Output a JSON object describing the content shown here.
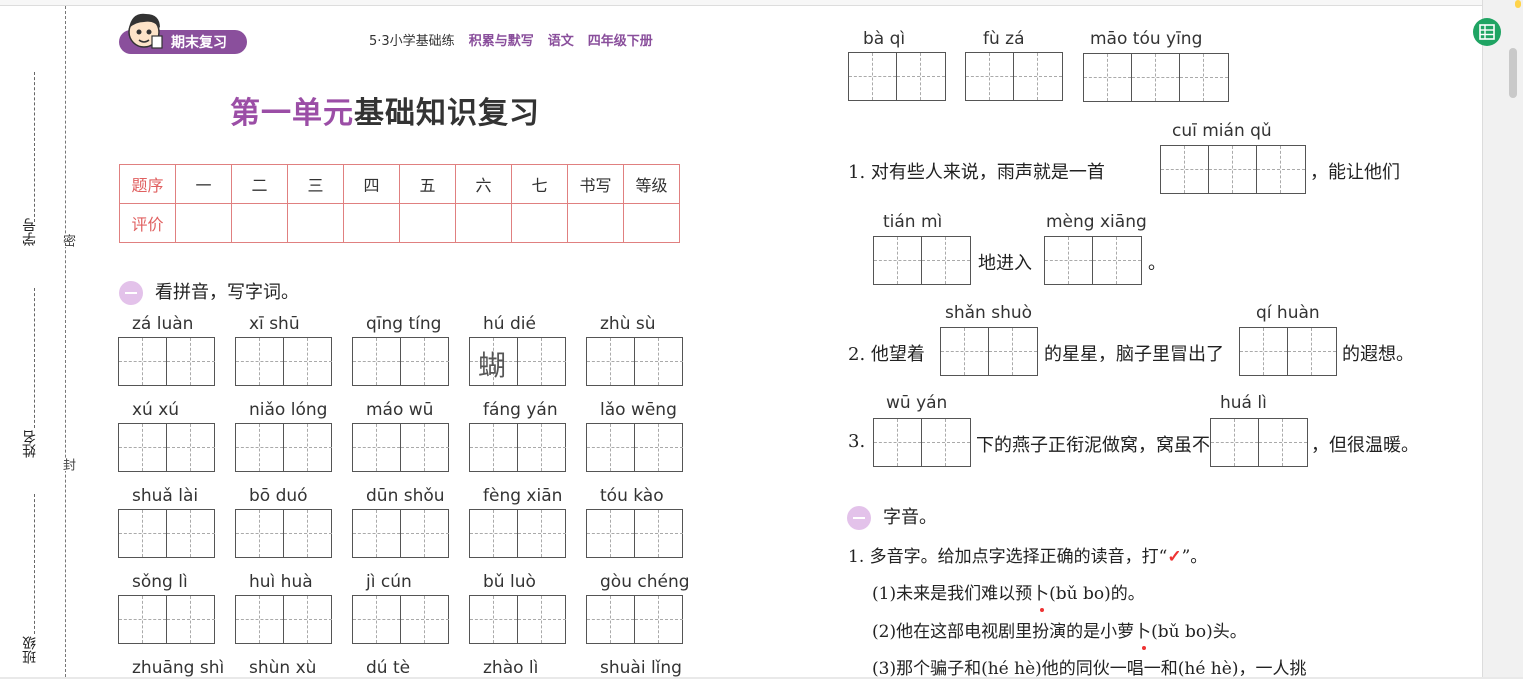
{
  "side_labels": {
    "student_no": "学号",
    "name": "姓名",
    "class": "班级",
    "seal_mi": "密",
    "seal_feng": "封"
  },
  "header": {
    "badge": "期末复习",
    "book": "5·3小学基础练",
    "series": "积累与默写",
    "subject": "语文",
    "grade": "四年级下册"
  },
  "title": {
    "prefix": "第一单元",
    "main": "基础知识复习"
  },
  "score_table": {
    "row1": [
      "题序",
      "一",
      "二",
      "三",
      "四",
      "五",
      "六",
      "七",
      "书写",
      "等级"
    ],
    "row2_head": "评价"
  },
  "section1": {
    "title": "看拼音，写字词。",
    "rows": [
      [
        {
          "py": "zá  luàn"
        },
        {
          "py": "xī   shū"
        },
        {
          "py": "qīng tíng"
        },
        {
          "py": "hú   dié",
          "filled": "蝴"
        },
        {
          "py": "zhù  sù"
        }
      ],
      [
        {
          "py": "xú   xú"
        },
        {
          "py": "niǎo lóng"
        },
        {
          "py": "máo  wū"
        },
        {
          "py": "fáng  yán"
        },
        {
          "py": "lǎo wēng"
        }
      ],
      [
        {
          "py": "shuǎ  lài"
        },
        {
          "py": "bō   duó"
        },
        {
          "py": "dūn shǒu"
        },
        {
          "py": "fèng xiān"
        },
        {
          "py": "tóu  kào"
        }
      ],
      [
        {
          "py": "sǒng   lì"
        },
        {
          "py": "huì  huà"
        },
        {
          "py": "jì   cún"
        },
        {
          "py": "bǔ   luò"
        },
        {
          "py": "gòu chéng"
        }
      ],
      [
        {
          "py": "zhuāng shì"
        },
        {
          "py": "shùn  xù"
        },
        {
          "py": "dú   tè"
        },
        {
          "py": "zhào   lì"
        },
        {
          "py": "shuài lǐng"
        }
      ]
    ]
  },
  "right_top": [
    {
      "py": "bà   qì"
    },
    {
      "py": "fù   zá"
    },
    {
      "py": "māo  tóu  yīng"
    }
  ],
  "fill_sentences": {
    "s1_py": "cuī  mián  qǔ",
    "s1_a": "1. 对有些人来说，雨声就是一首",
    "s1_b": "，能让他们",
    "s1_py2": "tián   mì",
    "s1_py3": "mèng xiāng",
    "s1_c": "地进入",
    "s1_d": "。",
    "s2_py1": "shǎn shuò",
    "s2_py2": "qí   huàn",
    "s2_a": "2. 他望着",
    "s2_b": "的星星，脑子里冒出了",
    "s2_c": "的遐想。",
    "s3_py1": "wū   yán",
    "s3_py2": "huá    lì",
    "s3_a": "3.",
    "s3_b": "下的燕子正衔泥做窝，窝虽不",
    "s3_c": "，但很温暖。"
  },
  "section2": {
    "title": "字音。",
    "q1": "1. 多音字。给加点字选择正确的读音，打“",
    "q1_end": "”。",
    "check": "✓",
    "items": [
      {
        "pre": "(1)未来是我们难以预",
        "dot": "卜",
        "post": "(bǔ   bo)的。"
      },
      {
        "pre": "(2)他在这部电视剧里扮演的是小萝",
        "dot": "卜",
        "post": "(bǔ   bo)头。"
      },
      {
        "pre": "(3)那个骗子和(hé   hè)他的同伙一唱一和(hé   hè)，一人挑",
        "dot": "",
        "post": ""
      }
    ]
  }
}
